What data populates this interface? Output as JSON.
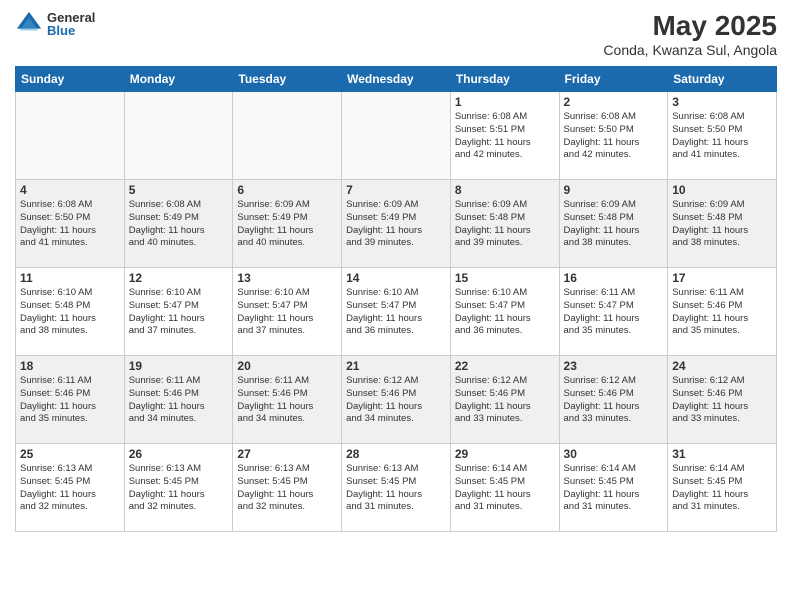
{
  "header": {
    "logo_general": "General",
    "logo_blue": "Blue",
    "title": "May 2025",
    "subtitle": "Conda, Kwanza Sul, Angola"
  },
  "days": [
    "Sunday",
    "Monday",
    "Tuesday",
    "Wednesday",
    "Thursday",
    "Friday",
    "Saturday"
  ],
  "weeks": [
    [
      {
        "day": "",
        "content": ""
      },
      {
        "day": "",
        "content": ""
      },
      {
        "day": "",
        "content": ""
      },
      {
        "day": "",
        "content": ""
      },
      {
        "day": "1",
        "content": "Sunrise: 6:08 AM\nSunset: 5:51 PM\nDaylight: 11 hours\nand 42 minutes."
      },
      {
        "day": "2",
        "content": "Sunrise: 6:08 AM\nSunset: 5:50 PM\nDaylight: 11 hours\nand 42 minutes."
      },
      {
        "day": "3",
        "content": "Sunrise: 6:08 AM\nSunset: 5:50 PM\nDaylight: 11 hours\nand 41 minutes."
      }
    ],
    [
      {
        "day": "4",
        "content": "Sunrise: 6:08 AM\nSunset: 5:50 PM\nDaylight: 11 hours\nand 41 minutes."
      },
      {
        "day": "5",
        "content": "Sunrise: 6:08 AM\nSunset: 5:49 PM\nDaylight: 11 hours\nand 40 minutes."
      },
      {
        "day": "6",
        "content": "Sunrise: 6:09 AM\nSunset: 5:49 PM\nDaylight: 11 hours\nand 40 minutes."
      },
      {
        "day": "7",
        "content": "Sunrise: 6:09 AM\nSunset: 5:49 PM\nDaylight: 11 hours\nand 39 minutes."
      },
      {
        "day": "8",
        "content": "Sunrise: 6:09 AM\nSunset: 5:48 PM\nDaylight: 11 hours\nand 39 minutes."
      },
      {
        "day": "9",
        "content": "Sunrise: 6:09 AM\nSunset: 5:48 PM\nDaylight: 11 hours\nand 38 minutes."
      },
      {
        "day": "10",
        "content": "Sunrise: 6:09 AM\nSunset: 5:48 PM\nDaylight: 11 hours\nand 38 minutes."
      }
    ],
    [
      {
        "day": "11",
        "content": "Sunrise: 6:10 AM\nSunset: 5:48 PM\nDaylight: 11 hours\nand 38 minutes."
      },
      {
        "day": "12",
        "content": "Sunrise: 6:10 AM\nSunset: 5:47 PM\nDaylight: 11 hours\nand 37 minutes."
      },
      {
        "day": "13",
        "content": "Sunrise: 6:10 AM\nSunset: 5:47 PM\nDaylight: 11 hours\nand 37 minutes."
      },
      {
        "day": "14",
        "content": "Sunrise: 6:10 AM\nSunset: 5:47 PM\nDaylight: 11 hours\nand 36 minutes."
      },
      {
        "day": "15",
        "content": "Sunrise: 6:10 AM\nSunset: 5:47 PM\nDaylight: 11 hours\nand 36 minutes."
      },
      {
        "day": "16",
        "content": "Sunrise: 6:11 AM\nSunset: 5:47 PM\nDaylight: 11 hours\nand 35 minutes."
      },
      {
        "day": "17",
        "content": "Sunrise: 6:11 AM\nSunset: 5:46 PM\nDaylight: 11 hours\nand 35 minutes."
      }
    ],
    [
      {
        "day": "18",
        "content": "Sunrise: 6:11 AM\nSunset: 5:46 PM\nDaylight: 11 hours\nand 35 minutes."
      },
      {
        "day": "19",
        "content": "Sunrise: 6:11 AM\nSunset: 5:46 PM\nDaylight: 11 hours\nand 34 minutes."
      },
      {
        "day": "20",
        "content": "Sunrise: 6:11 AM\nSunset: 5:46 PM\nDaylight: 11 hours\nand 34 minutes."
      },
      {
        "day": "21",
        "content": "Sunrise: 6:12 AM\nSunset: 5:46 PM\nDaylight: 11 hours\nand 34 minutes."
      },
      {
        "day": "22",
        "content": "Sunrise: 6:12 AM\nSunset: 5:46 PM\nDaylight: 11 hours\nand 33 minutes."
      },
      {
        "day": "23",
        "content": "Sunrise: 6:12 AM\nSunset: 5:46 PM\nDaylight: 11 hours\nand 33 minutes."
      },
      {
        "day": "24",
        "content": "Sunrise: 6:12 AM\nSunset: 5:46 PM\nDaylight: 11 hours\nand 33 minutes."
      }
    ],
    [
      {
        "day": "25",
        "content": "Sunrise: 6:13 AM\nSunset: 5:45 PM\nDaylight: 11 hours\nand 32 minutes."
      },
      {
        "day": "26",
        "content": "Sunrise: 6:13 AM\nSunset: 5:45 PM\nDaylight: 11 hours\nand 32 minutes."
      },
      {
        "day": "27",
        "content": "Sunrise: 6:13 AM\nSunset: 5:45 PM\nDaylight: 11 hours\nand 32 minutes."
      },
      {
        "day": "28",
        "content": "Sunrise: 6:13 AM\nSunset: 5:45 PM\nDaylight: 11 hours\nand 31 minutes."
      },
      {
        "day": "29",
        "content": "Sunrise: 6:14 AM\nSunset: 5:45 PM\nDaylight: 11 hours\nand 31 minutes."
      },
      {
        "day": "30",
        "content": "Sunrise: 6:14 AM\nSunset: 5:45 PM\nDaylight: 11 hours\nand 31 minutes."
      },
      {
        "day": "31",
        "content": "Sunrise: 6:14 AM\nSunset: 5:45 PM\nDaylight: 11 hours\nand 31 minutes."
      }
    ]
  ]
}
